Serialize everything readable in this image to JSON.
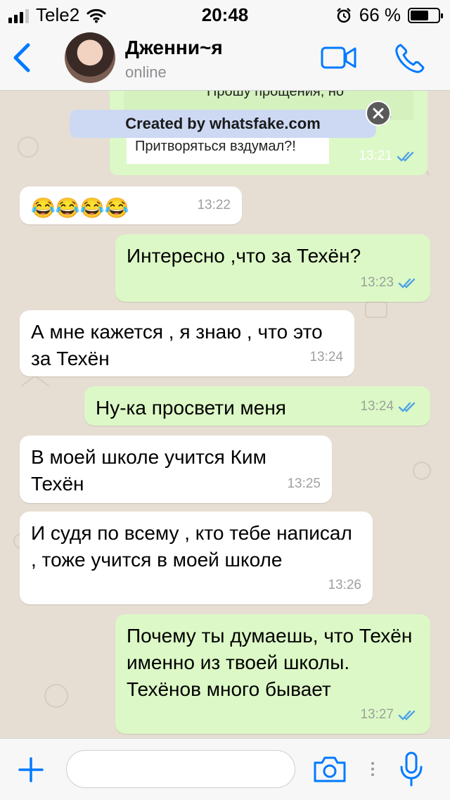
{
  "status_bar": {
    "carrier": "Tele2",
    "time": "20:48",
    "battery_percent_label": "66 %",
    "battery_level": 0.66
  },
  "header": {
    "contact_name": "Дженни~я",
    "contact_status": "online",
    "icons": [
      "back-chevron-icon",
      "video-call-icon",
      "phone-icon"
    ]
  },
  "quoted_message": {
    "line1": "Прошу прощения, но",
    "line2": "Притворяться вздумал?!",
    "time": "13:21"
  },
  "watermark": {
    "text": "Created by whatsfake.com"
  },
  "messages": [
    {
      "dir": "in",
      "text": "😂😂😂😂",
      "time": "13:22"
    },
    {
      "dir": "out",
      "text": "Интересно ,что за Техён?",
      "time": "13:23"
    },
    {
      "dir": "in",
      "text": "А мне кажется , я знаю , что это за Техён",
      "time": "13:24"
    },
    {
      "dir": "out",
      "text": "Ну-ка  просвети меня",
      "time": "13:24"
    },
    {
      "dir": "in",
      "text": "В моей школе учится Ким Техён",
      "time": "13:25"
    },
    {
      "dir": "in",
      "text": "И судя по всему , кто тебе написал ,  тоже учится в моей школе",
      "time": "13:26"
    },
    {
      "dir": "out",
      "text": "Почему ты думаешь, что Техён именно из твоей школы. Техёнов много бывает",
      "time": "13:27"
    }
  ],
  "input_bar": {
    "placeholder": "",
    "icons": [
      "plus-icon",
      "camera-icon",
      "microphone-icon"
    ]
  },
  "colors": {
    "accent": "#007aff",
    "outgoing_bubble": "#dcf8c6",
    "incoming_bubble": "#ffffff",
    "read_ticks": "#4fa3e6",
    "chat_background": "#e6ded3"
  }
}
